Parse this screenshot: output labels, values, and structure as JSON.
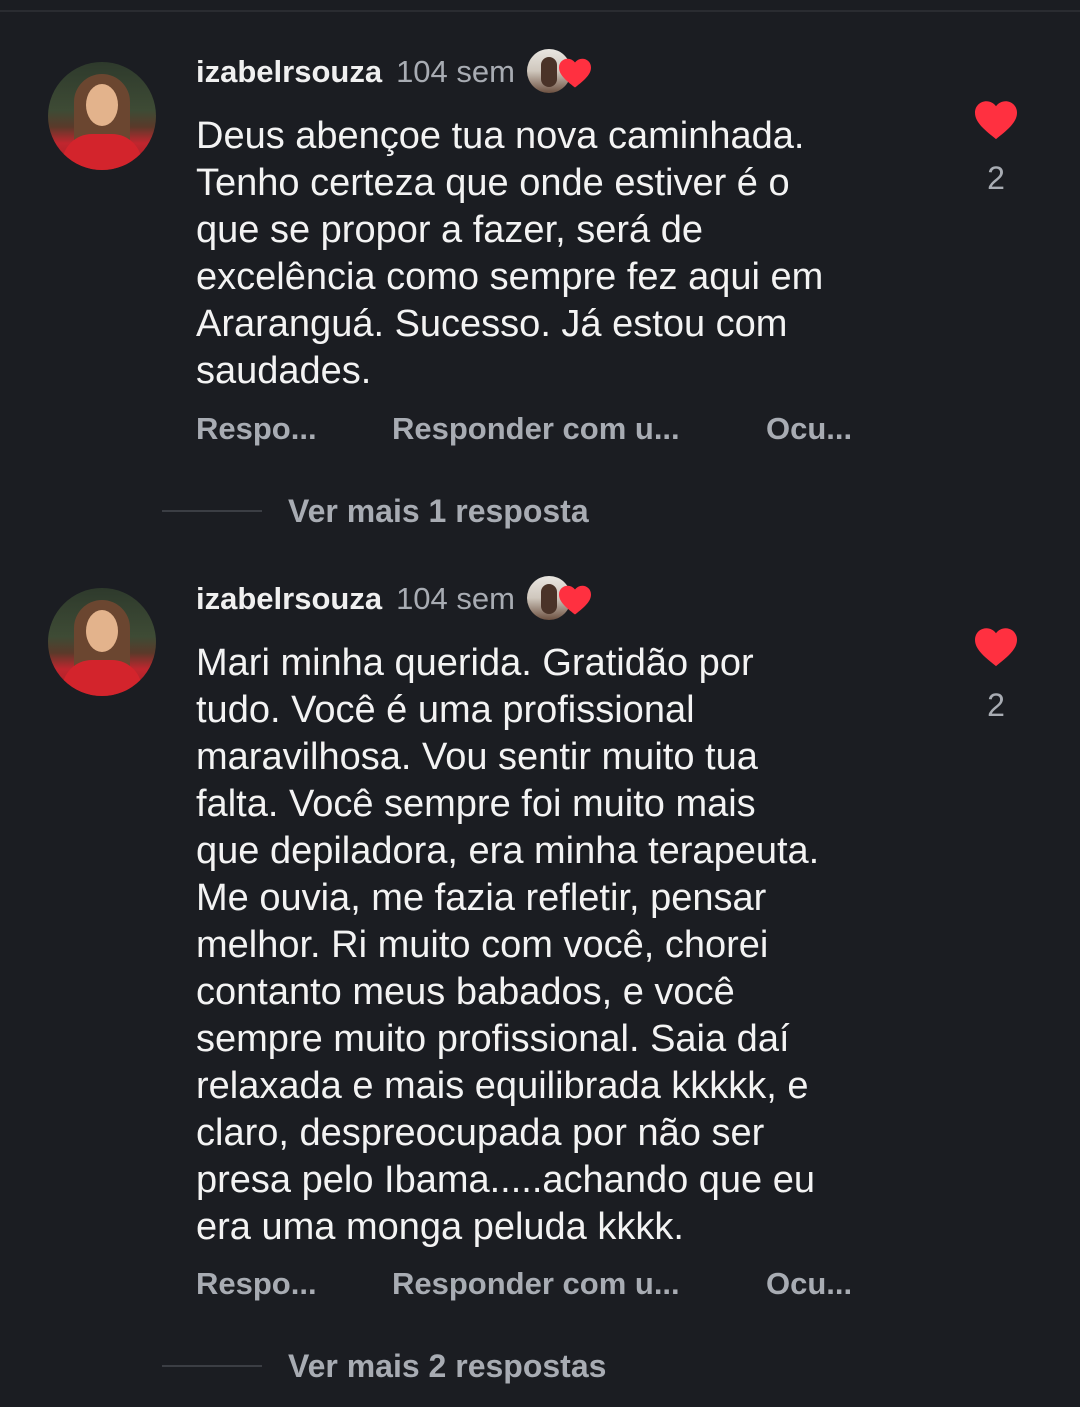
{
  "colors": {
    "background": "#1b1d22",
    "text": "#f3f3f3",
    "muted": "#a8acb3",
    "heart": "#ff3040"
  },
  "comments": [
    {
      "username": "izabelrsouza",
      "time": "104 sem",
      "text": "Deus abençoe tua nova caminhada.\nTenho certeza que onde estiver é o\nque se propor a fazer, será de\nexcelência como sempre fez aqui em\nAraranguá. Sucesso. Já estou com\nsaudades.",
      "like_count": "2",
      "actions": [
        "Respo...",
        "Responder com u...",
        "Ocu..."
      ],
      "replies_label": "Ver mais 1 resposta"
    },
    {
      "username": "izabelrsouza",
      "time": "104 sem",
      "text": "Mari minha querida. Gratidão por\ntudo. Você é uma profissional\nmaravilhosa. Vou sentir muito tua\nfalta. Você sempre foi muito mais\nque depiladora, era minha terapeuta.\nMe ouvia, me fazia refletir, pensar\nmelhor. Ri muito com você, chorei\ncontanto meus babados, e você\nsempre muito profissional. Saia daí\nrelaxada e mais equilibrada kkkkk, e\nclaro, despreocupada por não ser\npresa pelo Ibama.....achando que eu\nera uma monga peluda kkkk.",
      "like_count": "2",
      "actions": [
        "Respo...",
        "Responder com u...",
        "Ocu..."
      ],
      "replies_label": "Ver mais 2 respostas"
    }
  ]
}
